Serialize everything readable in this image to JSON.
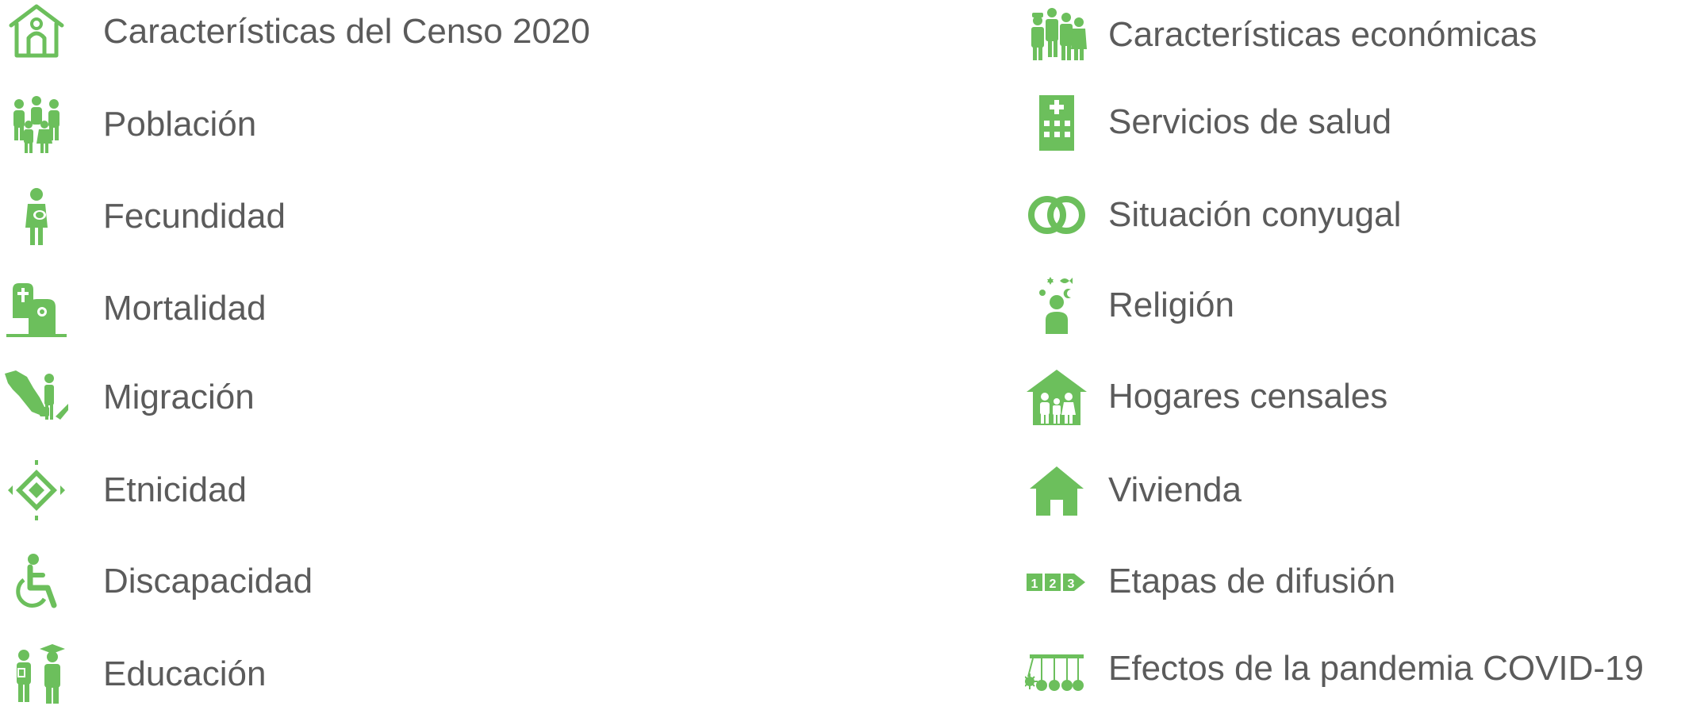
{
  "accent_color": "#6cbf5c",
  "text_color": "#5b5b5b",
  "left_column": [
    {
      "label": "Características del Censo 2020",
      "icon": "census-house-icon"
    },
    {
      "label": "Población",
      "icon": "population-group-icon"
    },
    {
      "label": "Fecundidad",
      "icon": "mother-child-icon"
    },
    {
      "label": "Mortalidad",
      "icon": "tombstones-icon"
    },
    {
      "label": "Migración",
      "icon": "mexico-map-person-icon"
    },
    {
      "label": "Etnicidad",
      "icon": "ethnic-diamond-pattern-icon"
    },
    {
      "label": "Discapacidad",
      "icon": "wheelchair-icon"
    },
    {
      "label": "Educación",
      "icon": "student-graduate-icon"
    }
  ],
  "right_column": [
    {
      "label": "Características económicas",
      "icon": "workers-icon"
    },
    {
      "label": "Servicios de salud",
      "icon": "hospital-building-icon"
    },
    {
      "label": "Situación conyugal",
      "icon": "wedding-rings-icon"
    },
    {
      "label": "Religión",
      "icon": "religion-person-symbols-icon"
    },
    {
      "label": "Hogares censales",
      "icon": "family-house-icon"
    },
    {
      "label": "Vivienda",
      "icon": "house-icon"
    },
    {
      "label": "Etapas de difusión",
      "icon": "stages-123-arrow-icon"
    },
    {
      "label": "Efectos de la pandemia COVID-19",
      "icon": "pandemic-pendulum-icon"
    }
  ]
}
